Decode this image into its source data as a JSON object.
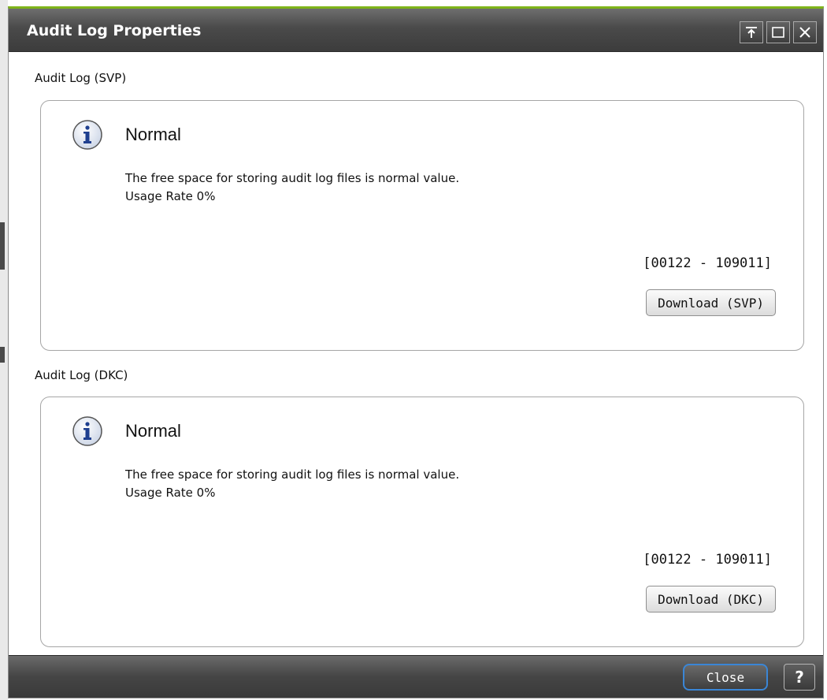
{
  "dialog": {
    "title": "Audit Log Properties",
    "window_buttons": [
      {
        "icon": "pin-icon"
      },
      {
        "icon": "maximize-icon"
      },
      {
        "icon": "close-icon"
      }
    ]
  },
  "sections": [
    {
      "label": "Audit Log (SVP)",
      "status_icon": "info-icon",
      "status": "Normal",
      "message": "The free space for storing audit log files is normal value.",
      "usage": "Usage Rate 0%",
      "range": "[00122 - 109011]",
      "download_label": "Download (SVP)"
    },
    {
      "label": "Audit Log (DKC)",
      "status_icon": "info-icon",
      "status": "Normal",
      "message": "The free space for storing audit log files is normal value.",
      "usage": "Usage Rate 0%",
      "range": "[00122 - 109011]",
      "download_label": "Download (DKC)"
    }
  ],
  "footer": {
    "close_label": "Close",
    "help_label": "?"
  },
  "colors": {
    "title_accent": "#7fb41a",
    "focus_ring": "#3a86d6",
    "info_icon": "#1f3f8f"
  }
}
